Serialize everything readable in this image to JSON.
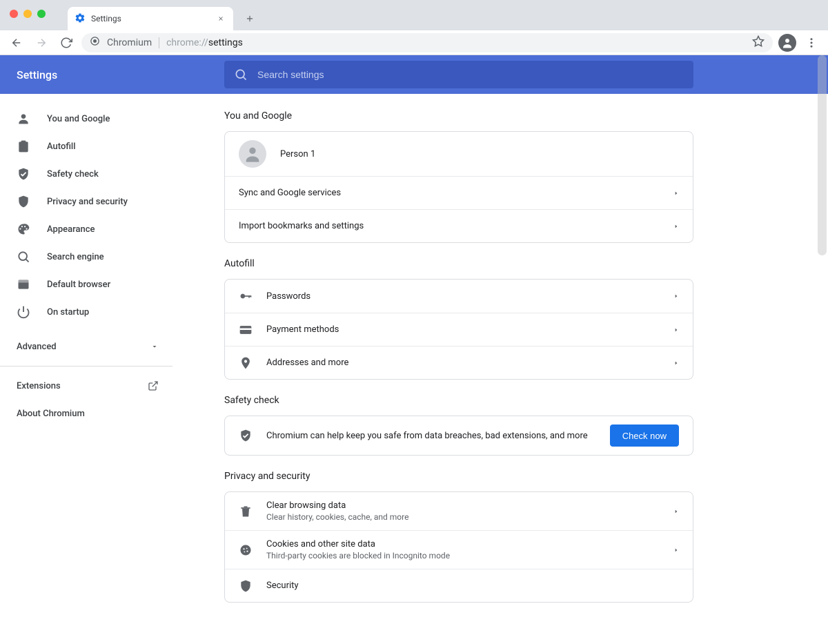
{
  "window": {
    "tab_title": "Settings"
  },
  "omnibox": {
    "site_label": "Chromium",
    "url_prefix": "chrome://",
    "url_path": "settings"
  },
  "header": {
    "title": "Settings",
    "search_placeholder": "Search settings"
  },
  "sidebar": {
    "items": [
      {
        "label": "You and Google"
      },
      {
        "label": "Autofill"
      },
      {
        "label": "Safety check"
      },
      {
        "label": "Privacy and security"
      },
      {
        "label": "Appearance"
      },
      {
        "label": "Search engine"
      },
      {
        "label": "Default browser"
      },
      {
        "label": "On startup"
      }
    ],
    "advanced_label": "Advanced",
    "extensions_label": "Extensions",
    "about_label": "About Chromium"
  },
  "sections": {
    "you_and_google": {
      "title": "You and Google",
      "profile_name": "Person 1",
      "sync_label": "Sync and Google services",
      "import_label": "Import bookmarks and settings"
    },
    "autofill": {
      "title": "Autofill",
      "passwords": "Passwords",
      "payment": "Payment methods",
      "addresses": "Addresses and more"
    },
    "safety": {
      "title": "Safety check",
      "desc": "Chromium can help keep you safe from data breaches, bad extensions, and more",
      "button": "Check now"
    },
    "privacy": {
      "title": "Privacy and security",
      "clear_title": "Clear browsing data",
      "clear_sub": "Clear history, cookies, cache, and more",
      "cookies_title": "Cookies and other site data",
      "cookies_sub": "Third-party cookies are blocked in Incognito mode",
      "security_title": "Security"
    }
  }
}
